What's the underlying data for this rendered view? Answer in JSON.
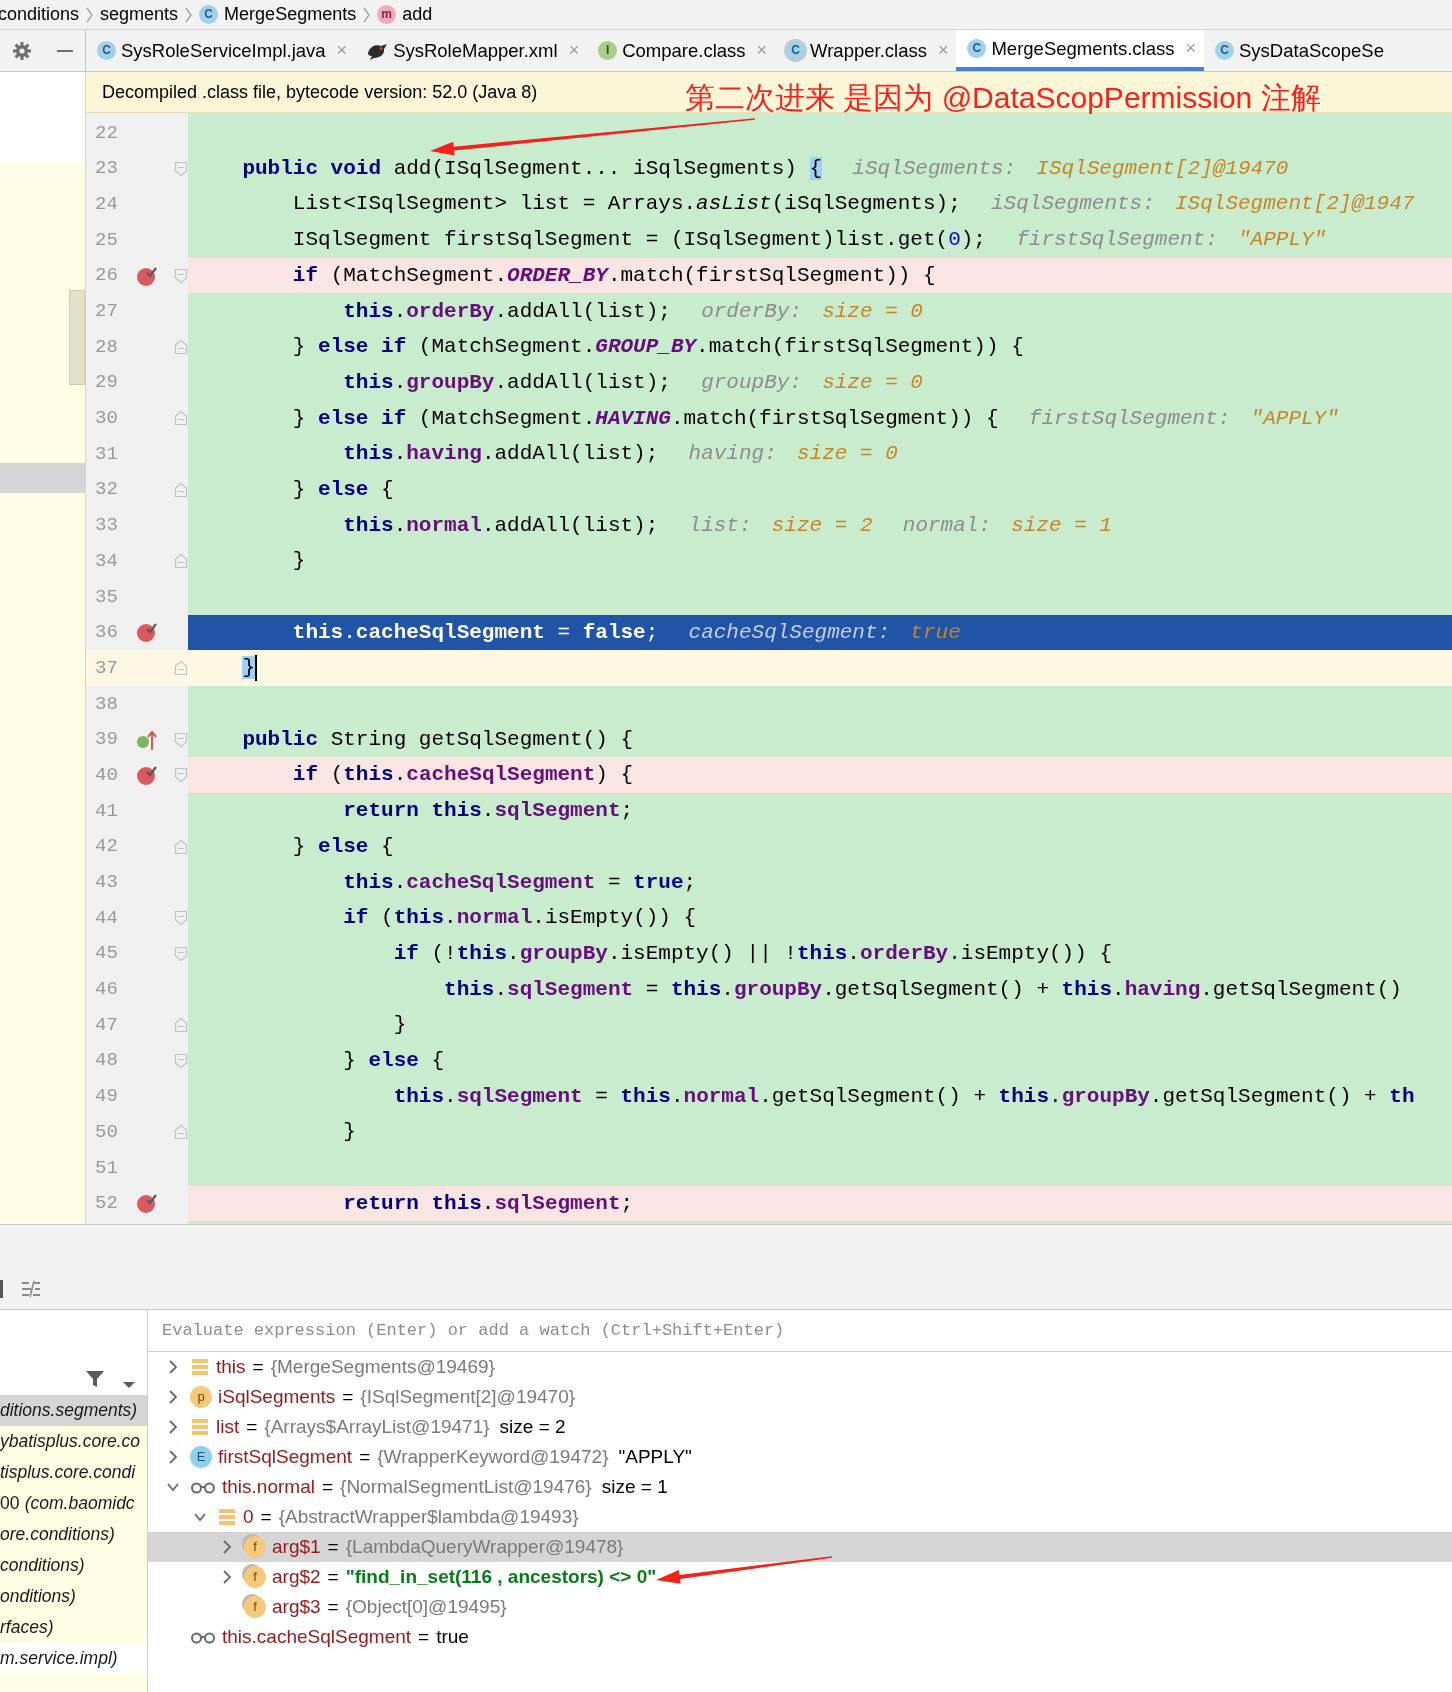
{
  "breadcrumbs": [
    {
      "label": "conditions"
    },
    {
      "label": "segments"
    },
    {
      "label": "MergeSegments",
      "icon": {
        "kind": "class",
        "letter": "C"
      }
    },
    {
      "label": "add",
      "icon": {
        "kind": "method",
        "letter": "m"
      }
    }
  ],
  "tabs": [
    {
      "label": "SysRoleServiceImpl.java",
      "icon": {
        "kind": "class",
        "letter": "C"
      },
      "selected": false,
      "close": "×"
    },
    {
      "label": "SysRoleMapper.xml",
      "icon": {
        "kind": "xml"
      },
      "selected": false,
      "close": "×"
    },
    {
      "label": "Compare.class",
      "icon": {
        "kind": "interface",
        "letter": "I"
      },
      "selected": false,
      "close": "×"
    },
    {
      "label": "Wrapper.class",
      "icon": {
        "kind": "abstract-class",
        "letter": "C"
      },
      "selected": false,
      "close": "×"
    },
    {
      "label": "MergeSegments.class",
      "icon": {
        "kind": "class",
        "letter": "C"
      },
      "selected": true,
      "close": "×"
    },
    {
      "label": "SysDataScopeSe",
      "icon": {
        "kind": "class",
        "letter": "C"
      },
      "selected": false
    }
  ],
  "notice": "Decompiled .class file, bytecode version: 52.0 (Java 8)",
  "annotation": "第二次进来 是因为 @DataScopPermission 注解",
  "editor": {
    "lines": [
      {
        "number": "22",
        "breakpoint": false
      },
      {
        "number": "23",
        "breakpoint": false,
        "fold_start": true,
        "code": [
          {
            "kind": "keyword",
            "text": "    public void"
          },
          {
            "kind": "plain",
            "text": " add(ISqlSegment... iSqlSegments) "
          },
          {
            "kind": "brace-match",
            "text": "{"
          }
        ],
        "hints": [
          {
            "name": "iSqlSegments:",
            "value": "ISqlSegment[2]@19470"
          }
        ]
      },
      {
        "number": "24",
        "breakpoint": false,
        "code": [
          {
            "kind": "plain",
            "text": "        List<ISqlSegment> list = Arrays."
          },
          {
            "kind": "static-call",
            "text": "asList"
          },
          {
            "kind": "plain",
            "text": "(iSqlSegments);"
          }
        ],
        "hints": [
          {
            "name": "iSqlSegments:",
            "value": "ISqlSegment[2]@1947"
          }
        ]
      },
      {
        "number": "25",
        "breakpoint": false,
        "code": [
          {
            "kind": "plain",
            "text": "        ISqlSegment firstSqlSegment = (ISqlSegment)list.get("
          },
          {
            "kind": "number",
            "text": "0"
          },
          {
            "kind": "plain",
            "text": ");"
          }
        ],
        "hints": [
          {
            "name": "firstSqlSegment:",
            "value": "\"APPLY\""
          }
        ]
      },
      {
        "number": "26",
        "breakpoint": true,
        "fold_start": true,
        "code": [
          {
            "kind": "keyword",
            "text": "        if"
          },
          {
            "kind": "plain",
            "text": " (MatchSegment."
          },
          {
            "kind": "constant",
            "text": "ORDER_BY"
          },
          {
            "kind": "plain",
            "text": ".match(firstSqlSegment)) {"
          }
        ]
      },
      {
        "number": "27",
        "breakpoint": false,
        "code": [
          {
            "kind": "keyword",
            "text": "            this"
          },
          {
            "kind": "plain",
            "text": "."
          },
          {
            "kind": "field",
            "text": "orderBy"
          },
          {
            "kind": "plain",
            "text": ".addAll(list);"
          }
        ],
        "hints": [
          {
            "name": "orderBy:",
            "value": "size = 0"
          }
        ]
      },
      {
        "number": "28",
        "breakpoint": false,
        "fold_end": true,
        "code": [
          {
            "kind": "plain",
            "text": "        } "
          },
          {
            "kind": "keyword",
            "text": "else if"
          },
          {
            "kind": "plain",
            "text": " (MatchSegment."
          },
          {
            "kind": "constant",
            "text": "GROUP_BY"
          },
          {
            "kind": "plain",
            "text": ".match(firstSqlSegment)) {"
          }
        ]
      },
      {
        "number": "29",
        "breakpoint": false,
        "code": [
          {
            "kind": "keyword",
            "text": "            this"
          },
          {
            "kind": "plain",
            "text": "."
          },
          {
            "kind": "field",
            "text": "groupBy"
          },
          {
            "kind": "plain",
            "text": ".addAll(list);"
          }
        ],
        "hints": [
          {
            "name": "groupBy:",
            "value": "size = 0"
          }
        ]
      },
      {
        "number": "30",
        "breakpoint": false,
        "fold_end": true,
        "code": [
          {
            "kind": "plain",
            "text": "        } "
          },
          {
            "kind": "keyword",
            "text": "else if"
          },
          {
            "kind": "plain",
            "text": " (MatchSegment."
          },
          {
            "kind": "constant",
            "text": "HAVING"
          },
          {
            "kind": "plain",
            "text": ".match(firstSqlSegment)) {"
          }
        ],
        "hints": [
          {
            "name": "firstSqlSegment:",
            "value": "\"APPLY\""
          }
        ]
      },
      {
        "number": "31",
        "breakpoint": false,
        "code": [
          {
            "kind": "keyword",
            "text": "            this"
          },
          {
            "kind": "plain",
            "text": "."
          },
          {
            "kind": "field",
            "text": "having"
          },
          {
            "kind": "plain",
            "text": ".addAll(list);"
          }
        ],
        "hints": [
          {
            "name": "having:",
            "value": "size = 0"
          }
        ]
      },
      {
        "number": "32",
        "breakpoint": false,
        "fold_end": true,
        "code": [
          {
            "kind": "plain",
            "text": "        } "
          },
          {
            "kind": "keyword",
            "text": "else"
          },
          {
            "kind": "plain",
            "text": " {"
          }
        ]
      },
      {
        "number": "33",
        "breakpoint": false,
        "code": [
          {
            "kind": "keyword",
            "text": "            this"
          },
          {
            "kind": "plain",
            "text": "."
          },
          {
            "kind": "field",
            "text": "normal"
          },
          {
            "kind": "plain",
            "text": ".addAll(list);"
          }
        ],
        "hints": [
          {
            "name": "list:",
            "value": "size = 2"
          },
          {
            "name": "normal:",
            "value": "size = 1"
          }
        ]
      },
      {
        "number": "34",
        "breakpoint": false,
        "fold_end": true,
        "code": [
          {
            "kind": "plain",
            "text": "        }"
          }
        ]
      },
      {
        "number": "35",
        "breakpoint": false
      },
      {
        "number": "36",
        "breakpoint": true,
        "current": true,
        "code": [
          {
            "kind": "keyword",
            "text": "        this"
          },
          {
            "kind": "plain",
            "text": "."
          },
          {
            "kind": "field",
            "text": "cacheSqlSegment"
          },
          {
            "kind": "plain",
            "text": " = "
          },
          {
            "kind": "keyword",
            "text": "false"
          },
          {
            "kind": "plain",
            "text": ";"
          }
        ],
        "hints": [
          {
            "name": "cacheSqlSegment:",
            "value": "true"
          }
        ]
      },
      {
        "number": "37",
        "breakpoint": false,
        "caret": true,
        "fold_end": true,
        "code": [
          {
            "kind": "brace-match",
            "text": "    }"
          }
        ]
      },
      {
        "number": "38",
        "breakpoint": false
      },
      {
        "number": "39",
        "breakpoint": false,
        "override": true,
        "fold_start": true,
        "code": [
          {
            "kind": "keyword",
            "text": "    public"
          },
          {
            "kind": "plain",
            "text": " String getSqlSegment() {"
          }
        ]
      },
      {
        "number": "40",
        "breakpoint": true,
        "fold_start": true,
        "code": [
          {
            "kind": "keyword",
            "text": "        if"
          },
          {
            "kind": "plain",
            "text": " ("
          },
          {
            "kind": "keyword",
            "text": "this"
          },
          {
            "kind": "plain",
            "text": "."
          },
          {
            "kind": "field",
            "text": "cacheSqlSegment"
          },
          {
            "kind": "plain",
            "text": ") {"
          }
        ]
      },
      {
        "number": "41",
        "breakpoint": false,
        "code": [
          {
            "kind": "keyword",
            "text": "            return this"
          },
          {
            "kind": "plain",
            "text": "."
          },
          {
            "kind": "field",
            "text": "sqlSegment"
          },
          {
            "kind": "plain",
            "text": ";"
          }
        ]
      },
      {
        "number": "42",
        "breakpoint": false,
        "fold_end": true,
        "code": [
          {
            "kind": "plain",
            "text": "        } "
          },
          {
            "kind": "keyword",
            "text": "else"
          },
          {
            "kind": "plain",
            "text": " {"
          }
        ]
      },
      {
        "number": "43",
        "breakpoint": false,
        "code": [
          {
            "kind": "keyword",
            "text": "            this"
          },
          {
            "kind": "plain",
            "text": "."
          },
          {
            "kind": "field",
            "text": "cacheSqlSegment"
          },
          {
            "kind": "plain",
            "text": " = "
          },
          {
            "kind": "keyword",
            "text": "true"
          },
          {
            "kind": "plain",
            "text": ";"
          }
        ]
      },
      {
        "number": "44",
        "breakpoint": false,
        "fold_start": true,
        "code": [
          {
            "kind": "keyword",
            "text": "            if"
          },
          {
            "kind": "plain",
            "text": " ("
          },
          {
            "kind": "keyword",
            "text": "this"
          },
          {
            "kind": "plain",
            "text": "."
          },
          {
            "kind": "field",
            "text": "normal"
          },
          {
            "kind": "plain",
            "text": ".isEmpty()) {"
          }
        ]
      },
      {
        "number": "45",
        "breakpoint": false,
        "fold_start": true,
        "code": [
          {
            "kind": "keyword",
            "text": "                if"
          },
          {
            "kind": "plain",
            "text": " (!"
          },
          {
            "kind": "keyword",
            "text": "this"
          },
          {
            "kind": "plain",
            "text": "."
          },
          {
            "kind": "field",
            "text": "groupBy"
          },
          {
            "kind": "plain",
            "text": ".isEmpty() || !"
          },
          {
            "kind": "keyword",
            "text": "this"
          },
          {
            "kind": "plain",
            "text": "."
          },
          {
            "kind": "field",
            "text": "orderBy"
          },
          {
            "kind": "plain",
            "text": ".isEmpty()) {"
          }
        ]
      },
      {
        "number": "46",
        "breakpoint": false,
        "code": [
          {
            "kind": "keyword",
            "text": "                    this"
          },
          {
            "kind": "plain",
            "text": "."
          },
          {
            "kind": "field",
            "text": "sqlSegment"
          },
          {
            "kind": "plain",
            "text": " = "
          },
          {
            "kind": "keyword",
            "text": "this"
          },
          {
            "kind": "plain",
            "text": "."
          },
          {
            "kind": "field",
            "text": "groupBy"
          },
          {
            "kind": "plain",
            "text": ".getSqlSegment() + "
          },
          {
            "kind": "keyword",
            "text": "this"
          },
          {
            "kind": "plain",
            "text": "."
          },
          {
            "kind": "field",
            "text": "having"
          },
          {
            "kind": "plain",
            "text": ".getSqlSegment()"
          }
        ]
      },
      {
        "number": "47",
        "breakpoint": false,
        "fold_end": true,
        "code": [
          {
            "kind": "plain",
            "text": "                }"
          }
        ]
      },
      {
        "number": "48",
        "breakpoint": false,
        "fold_start": true,
        "code": [
          {
            "kind": "plain",
            "text": "            } "
          },
          {
            "kind": "keyword",
            "text": "else"
          },
          {
            "kind": "plain",
            "text": " {"
          }
        ]
      },
      {
        "number": "49",
        "breakpoint": false,
        "code": [
          {
            "kind": "keyword",
            "text": "                this"
          },
          {
            "kind": "plain",
            "text": "."
          },
          {
            "kind": "field",
            "text": "sqlSegment"
          },
          {
            "kind": "plain",
            "text": " = "
          },
          {
            "kind": "keyword",
            "text": "this"
          },
          {
            "kind": "plain",
            "text": "."
          },
          {
            "kind": "field",
            "text": "normal"
          },
          {
            "kind": "plain",
            "text": ".getSqlSegment() + "
          },
          {
            "kind": "keyword",
            "text": "this"
          },
          {
            "kind": "plain",
            "text": "."
          },
          {
            "kind": "field",
            "text": "groupBy"
          },
          {
            "kind": "plain",
            "text": ".getSqlSegment() + "
          },
          {
            "kind": "keyword",
            "text": "th"
          }
        ]
      },
      {
        "number": "50",
        "breakpoint": false,
        "fold_end": true,
        "code": [
          {
            "kind": "plain",
            "text": "            }"
          }
        ]
      },
      {
        "number": "51",
        "breakpoint": false
      },
      {
        "number": "52",
        "breakpoint": true,
        "code": [
          {
            "kind": "keyword",
            "text": "            return this"
          },
          {
            "kind": "plain",
            "text": "."
          },
          {
            "kind": "field",
            "text": "sqlSegment"
          },
          {
            "kind": "plain",
            "text": ";"
          }
        ]
      }
    ]
  },
  "frames": {
    "items": [
      {
        "text": "ditions.segments)",
        "selected": true,
        "library": true
      },
      {
        "text": "ybatisplus.core.co",
        "selected": false,
        "library": true
      },
      {
        "text": "tisplus.core.condi",
        "selected": false,
        "library": true
      },
      {
        "line": "00",
        "text": "(com.baomidc",
        "selected": false,
        "library": true
      },
      {
        "text": "ore.conditions)",
        "selected": false,
        "library": true
      },
      {
        "text": "conditions)",
        "selected": false,
        "library": true
      },
      {
        "text": "onditions)",
        "selected": false,
        "library": true
      },
      {
        "text": "rfaces)",
        "selected": false,
        "library": true
      },
      {
        "text": "m.service.impl)",
        "selected": false,
        "library": false
      }
    ]
  },
  "variables": {
    "placeholder": "Evaluate expression (Enter) or add a watch (Ctrl+Shift+Enter)",
    "items": [
      {
        "kind": "fields",
        "name": "this",
        "operator": "=",
        "value": "{MergeSegments@19469}",
        "reference": true,
        "string": false,
        "expanded": false,
        "selected": false
      },
      {
        "kind": "param",
        "badge": "p",
        "name": "iSqlSegments",
        "operator": "=",
        "value": "{ISqlSegment[2]@19470}",
        "reference": true,
        "string": false,
        "expanded": false,
        "selected": false
      },
      {
        "kind": "fields",
        "name": "list",
        "operator": "=",
        "value": "{Arrays$ArrayList@19471}",
        "reference": true,
        "string": false,
        "detail": "size = 2",
        "expanded": false,
        "selected": false
      },
      {
        "kind": "enum",
        "badge": "E",
        "name": "firstSqlSegment",
        "operator": "=",
        "value": "{WrapperKeyword@19472}",
        "reference": true,
        "string": false,
        "detail": "\"APPLY\"",
        "expanded": false,
        "selected": false
      },
      {
        "kind": "watch",
        "name": "this.normal",
        "operator": "=",
        "value": "{NormalSegmentList@19476}",
        "reference": true,
        "string": false,
        "detail": "size = 1",
        "expanded": true,
        "selected": false,
        "children": [
          {
            "kind": "fields",
            "name": "0",
            "operator": "=",
            "value": "{AbstractWrapper$lambda@19493}",
            "reference": true,
            "string": false,
            "expanded": true,
            "selected": false,
            "children": [
              {
                "kind": "field",
                "badge": "f",
                "name": "arg$1",
                "operator": "=",
                "value": "{LambdaQueryWrapper@19478}",
                "reference": true,
                "string": false,
                "expanded": false,
                "selected": true
              },
              {
                "kind": "field",
                "badge": "f",
                "name": "arg$2",
                "operator": "=",
                "value": "\"find_in_set(116 , ancestors) <> 0\"",
                "string": true,
                "expanded": false,
                "selected": false
              },
              {
                "kind": "field",
                "badge": "f",
                "name": "arg$3",
                "operator": "=",
                "value": "{Object[0]@19495}",
                "reference": true,
                "string": false,
                "selected": false
              }
            ]
          }
        ]
      },
      {
        "kind": "watch",
        "name": "this.cacheSqlSegment",
        "operator": "=",
        "value": "true",
        "reference": false,
        "string": false,
        "selected": false
      }
    ]
  }
}
